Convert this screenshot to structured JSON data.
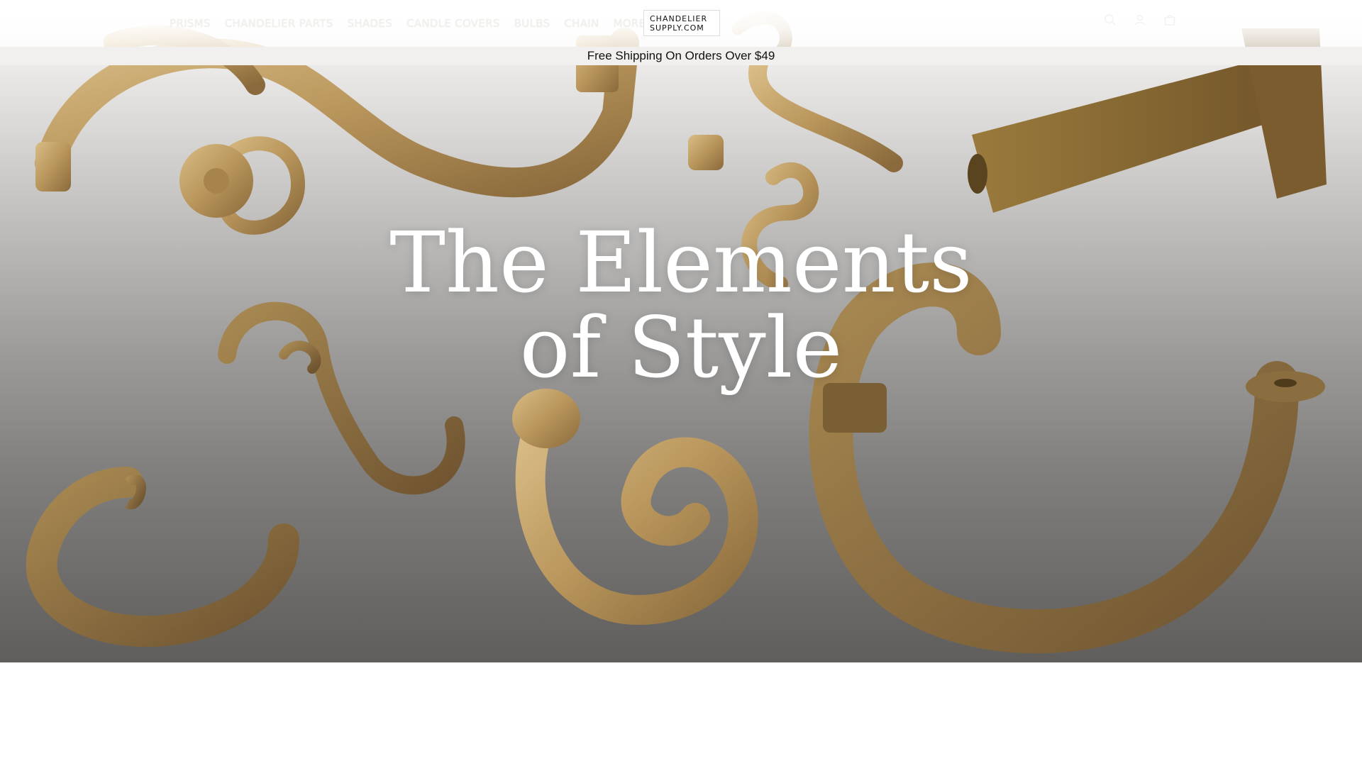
{
  "header": {
    "nav": [
      "PRISMS",
      "CHANDELIER PARTS",
      "SHADES",
      "CANDLE COVERS",
      "BULBS",
      "CHAIN",
      "MORE"
    ],
    "logo": {
      "line1": "CHANDELIER",
      "line2": "SUPPLY.COM"
    },
    "icons": [
      "search-icon",
      "account-icon",
      "cart-icon"
    ]
  },
  "announcement": "Free Shipping On Orders Over $49",
  "hero": {
    "title_line1": "The Elements",
    "title_line2": "of Style"
  },
  "colors": {
    "brass_light": "#c7a66f",
    "brass_dark": "#8a6a3c",
    "announcement_bg": "#f1f0ee"
  }
}
